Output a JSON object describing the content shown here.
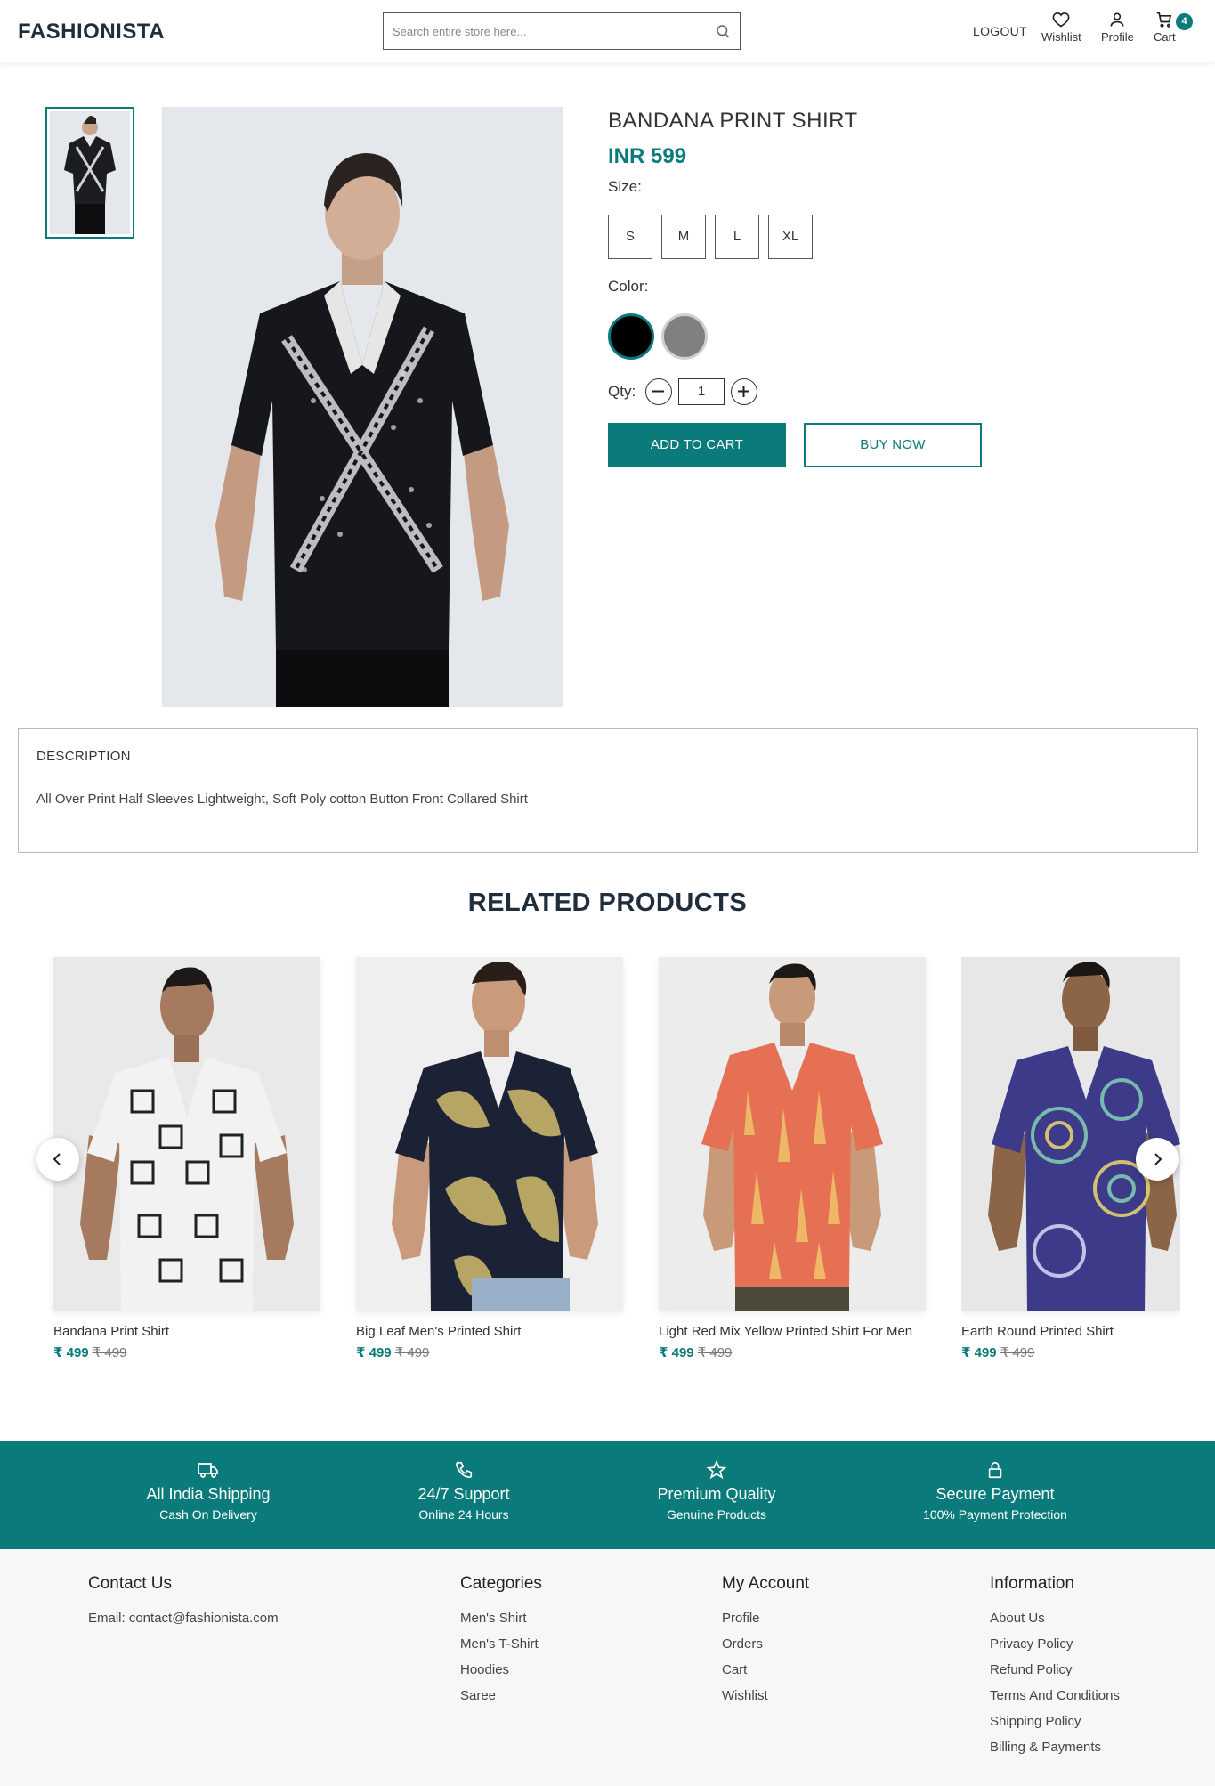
{
  "header": {
    "logo": "FASHIONISTA",
    "search_placeholder": "Search entire store here...",
    "logout": "LOGOUT",
    "wishlist": "Wishlist",
    "profile": "Profile",
    "cart": "Cart",
    "cart_count": "4"
  },
  "product": {
    "title": "BANDANA PRINT SHIRT",
    "price": "INR 599",
    "size_label": "Size:",
    "sizes": [
      "S",
      "M",
      "L",
      "XL"
    ],
    "color_label": "Color:",
    "colors": [
      "#000000",
      "#808080"
    ],
    "qty_label": "Qty:",
    "qty_value": "1",
    "add_to_cart": "ADD TO CART",
    "buy_now": "BUY NOW"
  },
  "description": {
    "heading": "DESCRIPTION",
    "text": "All Over Print Half Sleeves Lightweight, Soft Poly cotton Button Front Collared Shirt"
  },
  "related": {
    "title": "RELATED PRODUCTS",
    "items": [
      {
        "name": "Bandana Print Shirt",
        "price": "₹ 499",
        "old_price": "₹ 499"
      },
      {
        "name": "Big Leaf Men's Printed Shirt",
        "price": "₹ 499",
        "old_price": "₹ 499"
      },
      {
        "name": "Light Red Mix Yellow Printed Shirt For Men",
        "price": "₹ 499",
        "old_price": "₹ 499"
      },
      {
        "name": "Earth Round Printed Shirt",
        "price": "₹ 499",
        "old_price": "₹ 499"
      }
    ]
  },
  "features": [
    {
      "title": "All India Shipping",
      "sub": "Cash On Delivery",
      "icon": "truck-icon"
    },
    {
      "title": "24/7 Support",
      "sub": "Online 24 Hours",
      "icon": "phone-icon"
    },
    {
      "title": "Premium Quality",
      "sub": "Genuine Products",
      "icon": "star-icon"
    },
    {
      "title": "Secure Payment",
      "sub": "100% Payment Protection",
      "icon": "lock-icon"
    }
  ],
  "footer": {
    "contact": {
      "heading": "Contact Us",
      "email": "Email: contact@fashionista.com"
    },
    "categories": {
      "heading": "Categories",
      "links": [
        "Men's Shirt",
        "Men's T-Shirt",
        "Hoodies",
        "Saree"
      ]
    },
    "account": {
      "heading": "My Account",
      "links": [
        "Profile",
        "Orders",
        "Cart",
        "Wishlist"
      ]
    },
    "information": {
      "heading": "Information",
      "links": [
        "About Us",
        "Privacy Policy",
        "Refund Policy",
        "Terms And Conditions",
        "Shipping Policy",
        "Billing & Payments"
      ]
    }
  },
  "theme": {
    "accent": "#0b7a7a"
  }
}
